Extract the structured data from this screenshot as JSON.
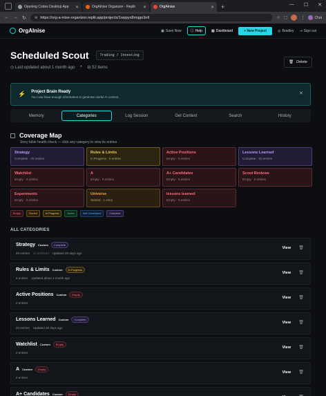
{
  "browser": {
    "tabs": [
      {
        "title": "Opening Codes Desktop App",
        "color": "#9aa0a6"
      },
      {
        "title": "OrgAInise Organizer - Replit",
        "color": "#f26207"
      },
      {
        "title": "OrgAInise",
        "color": "#e8483a"
      }
    ],
    "url": "https://org-a-inise-organizer.replit.app/projects/1wppyx8mqgo3etl",
    "chat_label": "Chat"
  },
  "nav": {
    "brand": "OrgAInise",
    "save_label": "Save Now",
    "help_label": "Help",
    "dashboard_label": "Dashboard",
    "new_project_label": "+ New Project",
    "user_label": "Bradley",
    "signout_label": "Sign out"
  },
  "project": {
    "title": "Scheduled Scout",
    "tag": "Trading / Investing",
    "updated": "Last updated about 1 month ago",
    "items": "52 items",
    "delete_label": "Delete"
  },
  "brain": {
    "title": "Project Brain Ready",
    "subtitle": "You now have enough information to generate useful AI context."
  },
  "tabs": [
    "Memory",
    "Categories",
    "Log Session",
    "Get Context",
    "Search",
    "History"
  ],
  "coverage": {
    "title": "Coverage Map",
    "subtitle": "Story bible health check — click any category to view its entries",
    "cells": [
      {
        "name": "Strategy",
        "status": "Complete · 20 entries",
        "kind": "complete"
      },
      {
        "name": "Rules & Limits",
        "status": "In Progress · 5 entries",
        "kind": "progress"
      },
      {
        "name": "Active Positions",
        "status": "Empty · 0 entries",
        "kind": "empty"
      },
      {
        "name": "Lessons Learned",
        "status": "Complete · 22 entries",
        "kind": "complete"
      },
      {
        "name": "Watchlist",
        "status": "Empty · 0 entries",
        "kind": "empty"
      },
      {
        "name": "A",
        "status": "Empty · 0 entries",
        "kind": "empty"
      },
      {
        "name": "A+ Candidates",
        "status": "Empty · 0 entries",
        "kind": "empty"
      },
      {
        "name": "Scout Reviews",
        "status": "Empty · 0 entries",
        "kind": "empty"
      },
      {
        "name": "Experiments",
        "status": "Empty · 0 entries",
        "kind": "empty"
      },
      {
        "name": "Universe",
        "status": "Started · 1 entry",
        "kind": "started"
      },
      {
        "name": "lessons learned",
        "status": "Empty · 0 entries",
        "kind": "empty"
      }
    ],
    "legend": [
      "Empty",
      "Started",
      "In Progress",
      "Active",
      "Well Developed",
      "Complete"
    ]
  },
  "all_categories_label": "ALL CATEGORIES",
  "categories": [
    {
      "name": "Strategy",
      "custom": "Custom",
      "badge": "Complete",
      "kind": "complete",
      "sub": "20 entries",
      "archived": "11 archived",
      "updated": "Updated 29 days ago"
    },
    {
      "name": "Rules & Limits",
      "custom": "Custom",
      "badge": "In Progress",
      "kind": "progress",
      "sub": "5 entries",
      "archived": "",
      "updated": "Updated about 1 month ago"
    },
    {
      "name": "Active Positions",
      "custom": "Custom",
      "badge": "Empty",
      "kind": "empty",
      "sub": "0 entries",
      "archived": "",
      "updated": ""
    },
    {
      "name": "Lessons Learned",
      "custom": "Custom",
      "badge": "Complete",
      "kind": "complete",
      "sub": "22 entries",
      "archived": "",
      "updated": "Updated 29 days ago"
    },
    {
      "name": "Watchlist",
      "custom": "Custom",
      "badge": "Empty",
      "kind": "empty",
      "sub": "0 entries",
      "archived": "",
      "updated": ""
    },
    {
      "name": "A",
      "custom": "Custom",
      "badge": "Empty",
      "kind": "empty",
      "sub": "0 entries",
      "archived": "",
      "updated": ""
    },
    {
      "name": "A+ Candidates",
      "custom": "Custom",
      "badge": "Empty",
      "kind": "empty",
      "sub": "0 entries",
      "archived": "",
      "updated": ""
    }
  ],
  "view_label": "View"
}
